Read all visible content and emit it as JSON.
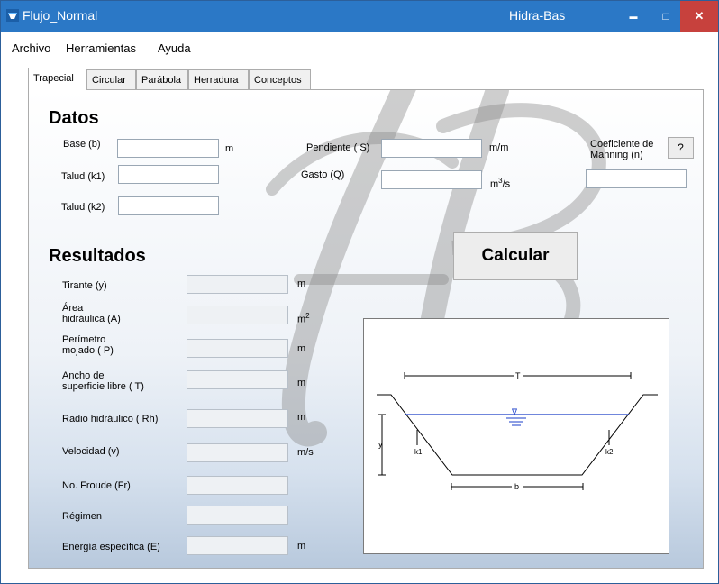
{
  "window": {
    "title": "Flujo_Normal",
    "app_name": "Hidra-Bas",
    "minimize_symbol": "▬",
    "maximize_symbol": "□",
    "close_symbol": "✕",
    "accent_color": "#2b78c6",
    "close_color": "#c7413d"
  },
  "menu": [
    "Archivo",
    "Herramientas",
    "Ayuda"
  ],
  "tabs": [
    "Trapecial",
    "Circular",
    "Parábola",
    "Herradura",
    "Conceptos"
  ],
  "active_tab": "Trapecial",
  "datos": {
    "heading": "Datos",
    "base_label": "Base (b)",
    "base_unit": "m",
    "talud1_label": "Talud (k1)",
    "talud2_label": "Talud (k2)",
    "pendiente_label": "Pendiente ( S)",
    "pendiente_unit": "m/m",
    "gasto_label": "Gasto (Q)",
    "gasto_unit_base": "m",
    "gasto_unit_sup": "3",
    "gasto_unit_tail": "/s",
    "manning_label_1": "Coeficiente de",
    "manning_label_2": "Manning (n)",
    "help_button": "?"
  },
  "resultados": {
    "heading": "Resultados",
    "tirante_label": "Tirante (y)",
    "tirante_unit": "m",
    "area_label_1": "Área",
    "area_label_2": "hidráulica (A)",
    "area_unit_base": "m",
    "area_unit_sup": "2",
    "perimetro_label_1": "Perímetro",
    "perimetro_label_2": "mojado ( P)",
    "perimetro_unit": "m",
    "ancho_label_1": "Ancho de",
    "ancho_label_2": "superficie libre ( T)",
    "ancho_unit": "m",
    "radio_label": "Radio hidráulico ( Rh)",
    "radio_unit": "m",
    "velocidad_label": "Velocidad (v)",
    "velocidad_unit": "m/s",
    "froude_label": "No. Froude (Fr)",
    "regimen_label": "Régimen",
    "energia_label": "Energía específica (E)",
    "energia_unit": "m"
  },
  "calcular_button": "Calcular",
  "diagram": {
    "top_width": "T",
    "bottom_width": "b",
    "depth": "y",
    "left_slope": "k1",
    "right_slope": "k2",
    "water_symbol": "∇",
    "water_color": "#1a3ec8"
  }
}
